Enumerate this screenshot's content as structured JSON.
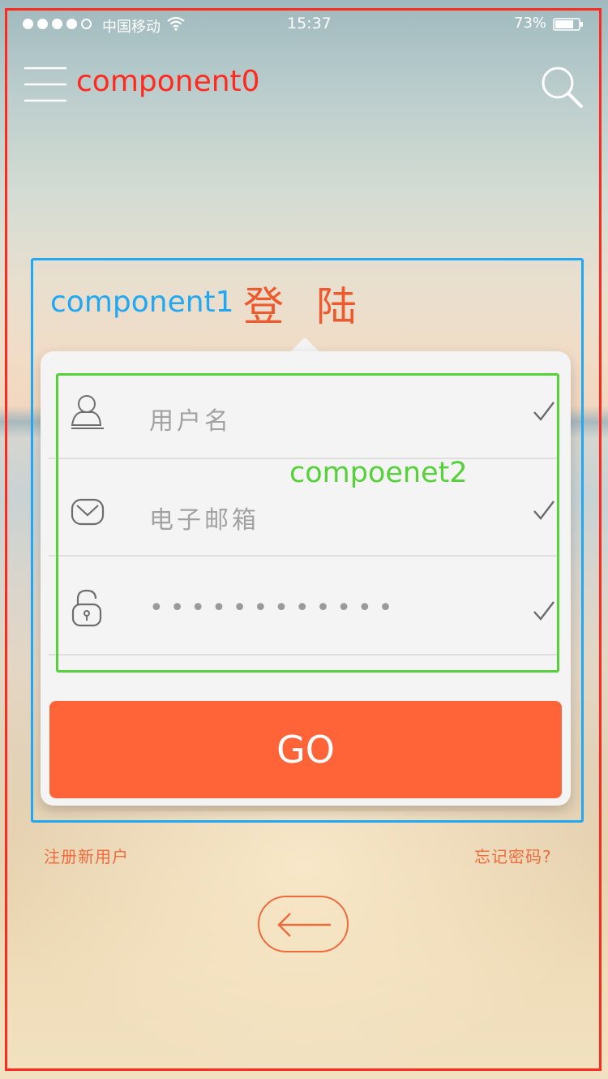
{
  "annotations": {
    "component0": "component0",
    "component1": "component1",
    "component2": "compoenet2"
  },
  "status_bar": {
    "carrier": "中国移动",
    "time": "15:37",
    "battery_percent": "73%",
    "signal_bars_filled": 4,
    "signal_bars_total": 5
  },
  "nav": {
    "menu_icon": "hamburger-menu-icon",
    "search_icon": "search-icon"
  },
  "login": {
    "title": "登陆",
    "fields": [
      {
        "icon": "user-icon",
        "placeholder": "用户名",
        "checked": true
      },
      {
        "icon": "mail-icon",
        "placeholder": "电子邮箱",
        "checked": true
      },
      {
        "icon": "unlock-icon",
        "value": "••••••••••••",
        "checked": true
      }
    ],
    "submit_label": "GO",
    "register_link": "注册新用户",
    "forgot_link": "忘记密码?"
  },
  "back_button": {
    "icon": "left-arrow-icon"
  },
  "colors": {
    "accent": "#ff6438",
    "annotation_component0": "#ff2a1f",
    "annotation_component1": "#22a8f2",
    "annotation_component2": "#57d13a"
  }
}
